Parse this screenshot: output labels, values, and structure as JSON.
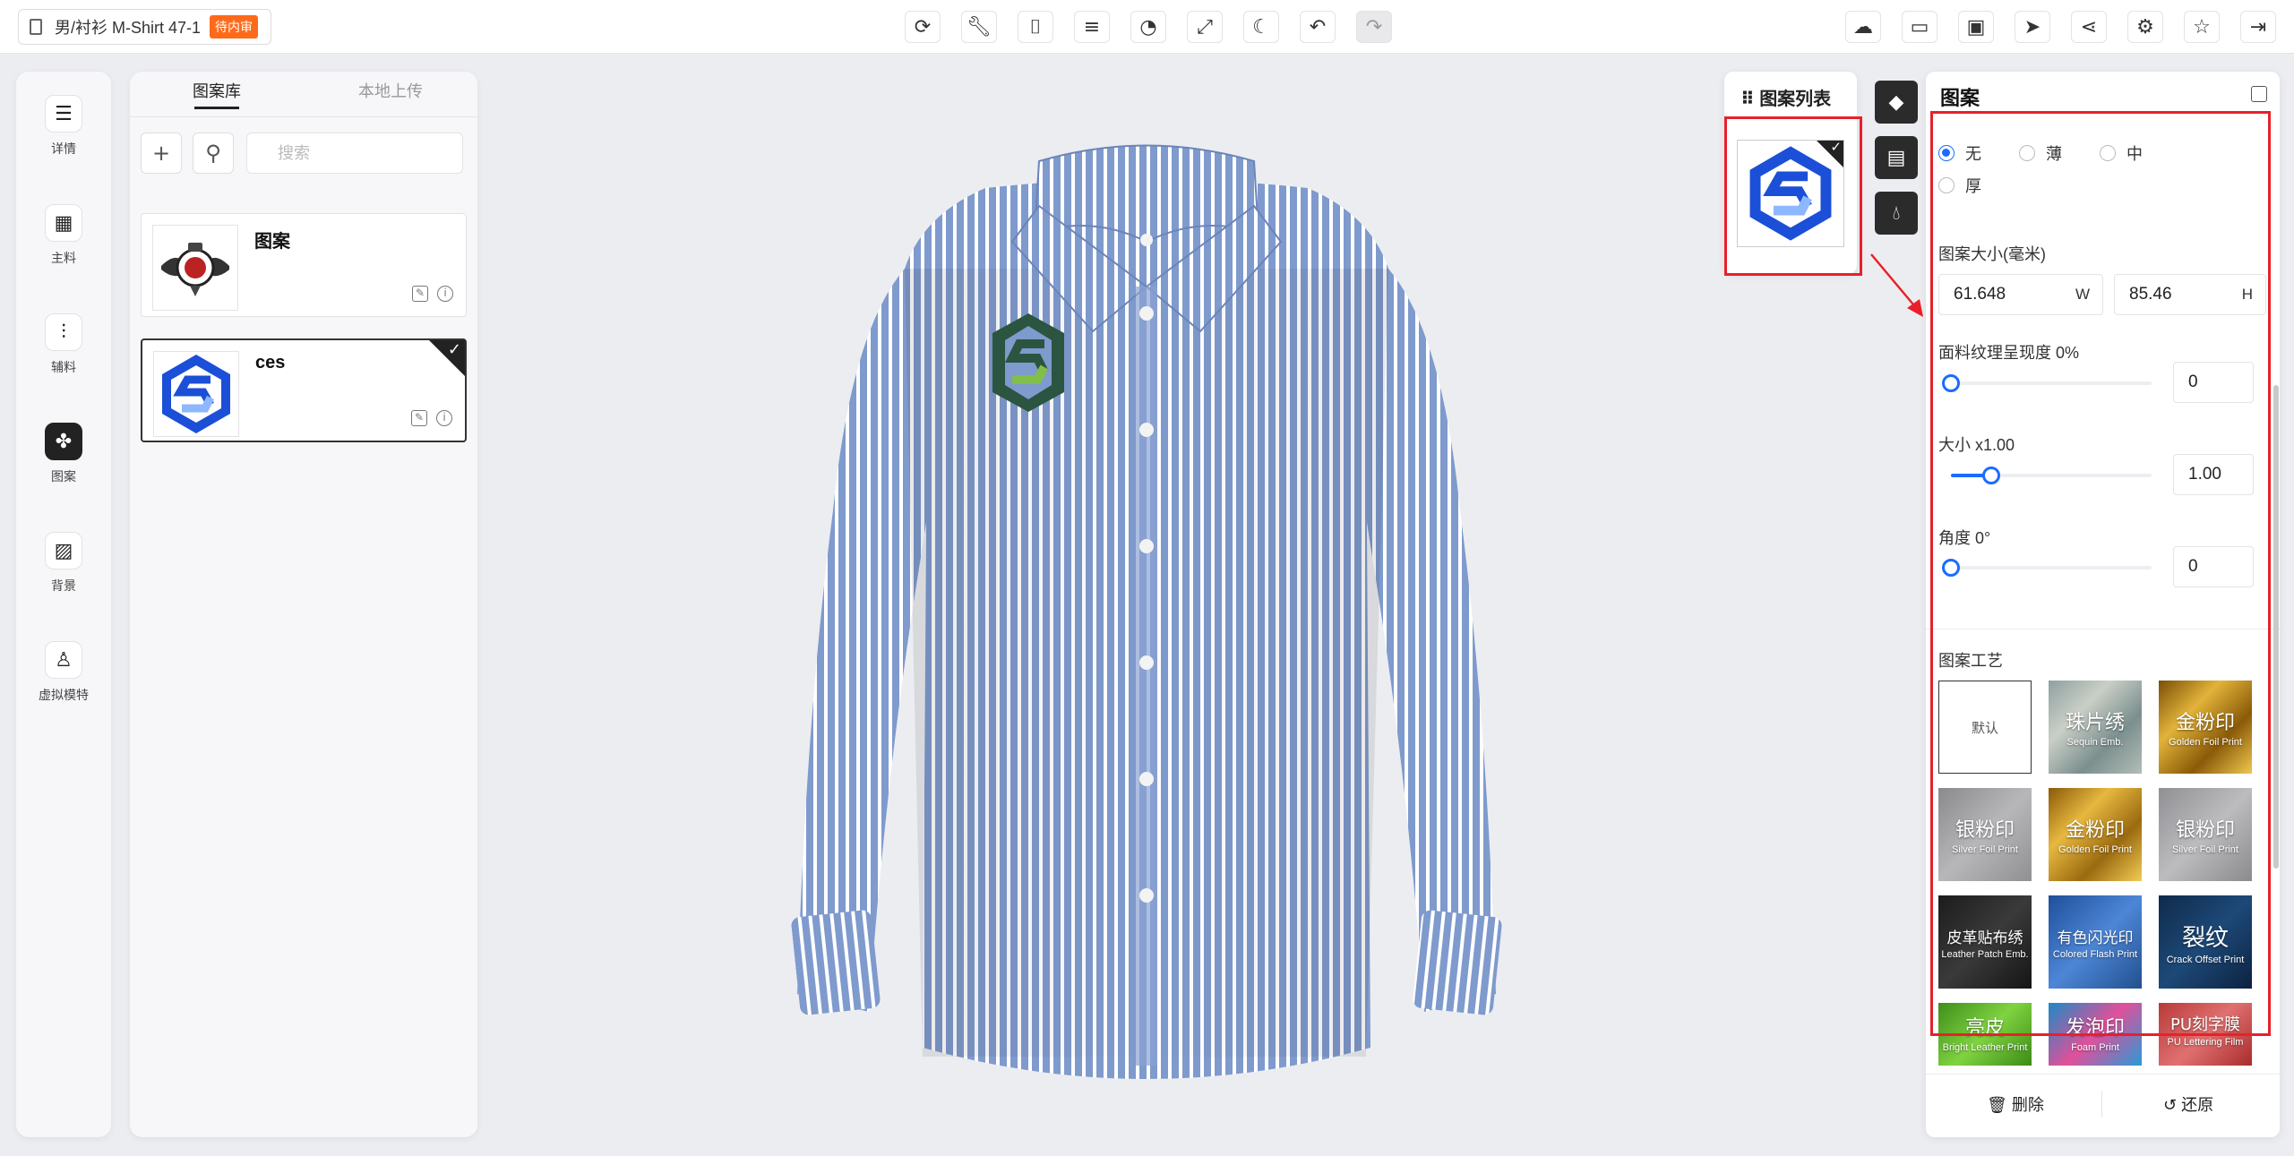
{
  "header": {
    "doc_title": "男/衬衫 M-Shirt 47-1",
    "status_badge": "待内审",
    "toolbar_icons": [
      "rotate-icon",
      "wrench-icon",
      "camera-icon",
      "notes-icon",
      "palette-icon",
      "fit-screen-icon",
      "night-mode-icon",
      "undo-icon",
      "redo-icon"
    ],
    "right_icons": [
      "cloud-upload-icon",
      "video-icon",
      "package-icon",
      "send-icon",
      "share-icon",
      "settings-icon",
      "star-icon",
      "exit-icon"
    ]
  },
  "rail": {
    "items": [
      {
        "label": "详情",
        "icon": "detail-icon"
      },
      {
        "label": "主料",
        "icon": "fabric-grid-icon"
      },
      {
        "label": "辅料",
        "icon": "zipper-icon"
      },
      {
        "label": "图案",
        "icon": "pattern-icon",
        "active": true
      },
      {
        "label": "背景",
        "icon": "background-icon"
      },
      {
        "label": "虚拟模特",
        "icon": "mannequin-icon"
      }
    ]
  },
  "library": {
    "tabs": [
      "图案库",
      "本地上传"
    ],
    "search_placeholder": "搜索",
    "patterns": [
      {
        "name": "图案",
        "thumbnail": "emblem-badge"
      },
      {
        "name": "ces",
        "thumbnail": "blue-s-logo",
        "selected": true
      }
    ]
  },
  "pattern_list": {
    "title": "图案列表"
  },
  "props": {
    "title": "图案",
    "thickness_options": [
      "无",
      "薄",
      "中",
      "厚"
    ],
    "thickness_selected": "无",
    "size_label": "图案大小(毫米)",
    "width_value": "61.648",
    "width_unit": "W",
    "height_value": "85.46",
    "height_unit": "H",
    "texture_label": "面料纹理呈现度 0%",
    "texture_value": "0",
    "texture_level": 0,
    "scale_label": "大小 x1.00",
    "scale_value": "1.00",
    "scale_level": 0.2,
    "angle_label": "角度 0°",
    "angle_value": "0",
    "angle_level": 0,
    "craft_label": "图案工艺",
    "crafts": [
      {
        "cn": "默认",
        "en": ""
      },
      {
        "cn": "珠片绣",
        "en": "Sequin Emb."
      },
      {
        "cn": "金粉印",
        "en": "Golden Foil Print"
      },
      {
        "cn": "银粉印",
        "en": "Silver Foil Print"
      },
      {
        "cn": "金粉印",
        "en": "Golden Foil Print"
      },
      {
        "cn": "银粉印",
        "en": "Silver Foil Print"
      },
      {
        "cn": "皮革贴布绣",
        "en": "Leather Patch Emb."
      },
      {
        "cn": "有色闪光印",
        "en": "Colored Flash Print"
      },
      {
        "cn": "裂纹",
        "en": "Crack Offset Print"
      },
      {
        "cn": "亮皮",
        "en": "Bright Leather Print"
      },
      {
        "cn": "发泡印",
        "en": "Foam Print"
      },
      {
        "cn": "PU刻字膜",
        "en": "PU Lettering Film"
      }
    ],
    "delete_label": "删除",
    "restore_label": "还原"
  },
  "colors": {
    "accent": "#1a6cff",
    "badge": "#ff6a1a",
    "highlight": "#e8202a",
    "shirt_base": "#7f9acd",
    "shirt_stripe": "#ffffff"
  }
}
